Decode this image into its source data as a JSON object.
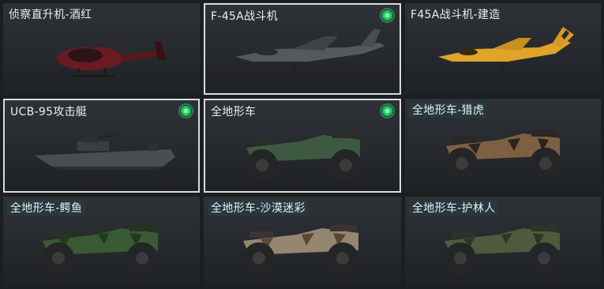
{
  "vehicles": [
    {
      "name": "侦察直升机-酒红",
      "owned": false,
      "selected": false,
      "icon": "helicopter",
      "color": "#7a1c24"
    },
    {
      "name": "F-45A战斗机",
      "owned": true,
      "selected": true,
      "icon": "fighter-jet",
      "color": "#5b5e62"
    },
    {
      "name": "F45A战斗机-建造",
      "owned": false,
      "selected": false,
      "icon": "fighter-jet",
      "color": "#e2a92b"
    },
    {
      "name": "UCB-95攻击艇",
      "owned": true,
      "selected": true,
      "icon": "attack-boat",
      "color": "#4b4f53"
    },
    {
      "name": "全地形车",
      "owned": true,
      "selected": true,
      "icon": "atv",
      "color": "#3f5a43"
    },
    {
      "name": "全地形车-猎虎",
      "owned": false,
      "selected": false,
      "icon": "atv",
      "color": "#8a6a45"
    },
    {
      "name": "全地形车-鳄鱼",
      "owned": false,
      "selected": false,
      "icon": "atv",
      "color": "#3a5a33"
    },
    {
      "name": "全地形车-沙漠迷彩",
      "owned": false,
      "selected": false,
      "icon": "atv",
      "color": "#9a8a70"
    },
    {
      "name": "全地形车-护林人",
      "owned": false,
      "selected": false,
      "icon": "atv",
      "color": "#4f5a3c"
    }
  ]
}
